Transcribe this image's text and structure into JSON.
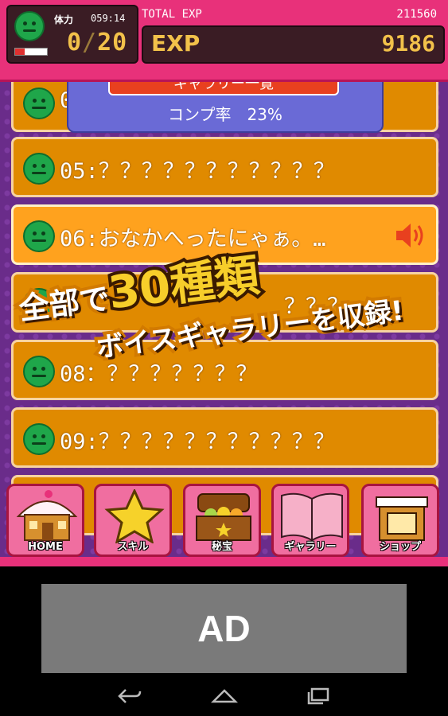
{
  "header": {
    "stamina_label": "体力",
    "stamina_timer": "059:14",
    "stamina_value": "0",
    "stamina_sep": "/",
    "stamina_max": "20",
    "stamina_fill": 0.3,
    "total_exp_label": "TOTAL EXP",
    "total_exp_value": "211560",
    "exp_label": "EXP",
    "exp_value": "9186"
  },
  "gallery": {
    "title": "ギャラリー一覧",
    "completion": "コンプ率　23%"
  },
  "rows": [
    {
      "text": "0"
    },
    {
      "text": "05:？？？？？？？？？？？"
    },
    {
      "text": "06:おなかへったにゃぁ。…"
    },
    {
      "text": "？？？"
    },
    {
      "text": "08：？？？？？？？"
    },
    {
      "text": "09:？？？？？？？？？？？"
    }
  ],
  "promo": {
    "line1_a": "全部で",
    "line1_b": "30種類",
    "line2": "ボイスギャラリーを収録!"
  },
  "nav": {
    "home": "HOME",
    "skill": "スキル",
    "secret": "秘宝",
    "gallery": "ギャラリー",
    "shop": "ショップ"
  },
  "ad": {
    "label": "AD"
  },
  "colors": {
    "header": "#e8317a",
    "row": "#e08a00",
    "row_selected": "#ffa21e",
    "background": "#6a2c8a"
  },
  "icons": [
    "smiley-face-icon",
    "speaker-icon",
    "house-icon",
    "star-icon",
    "treasure-chest-icon",
    "book-icon",
    "shop-icon",
    "back-icon",
    "home-icon",
    "recents-icon"
  ]
}
